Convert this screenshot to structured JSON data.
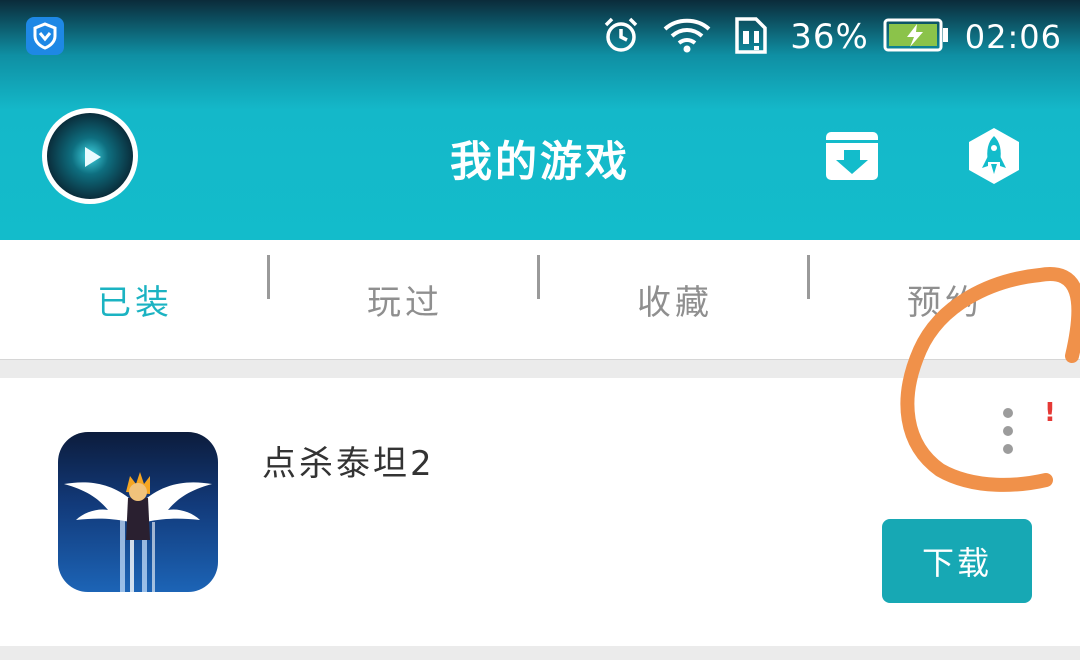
{
  "status_bar": {
    "battery_percent": "36%",
    "time": "02:06",
    "icons": [
      "shield-icon",
      "alarm-icon",
      "wifi-icon",
      "sim-alert-icon",
      "battery-charging-icon"
    ]
  },
  "header": {
    "title": "我的游戏",
    "avatar_icon": "avatar",
    "buttons": [
      {
        "name": "download-manager-icon"
      },
      {
        "name": "rocket-icon"
      }
    ],
    "colors": {
      "accent": "#13bccb"
    }
  },
  "tabs": [
    {
      "label": "已装",
      "active": true
    },
    {
      "label": "玩过",
      "active": false
    },
    {
      "label": "收藏",
      "active": false
    },
    {
      "label": "预约",
      "active": false
    }
  ],
  "games": [
    {
      "name": "点杀泰坦2",
      "action_label": "下载",
      "alert_mark": "!"
    }
  ],
  "annotation": {
    "color": "#f0914a"
  }
}
